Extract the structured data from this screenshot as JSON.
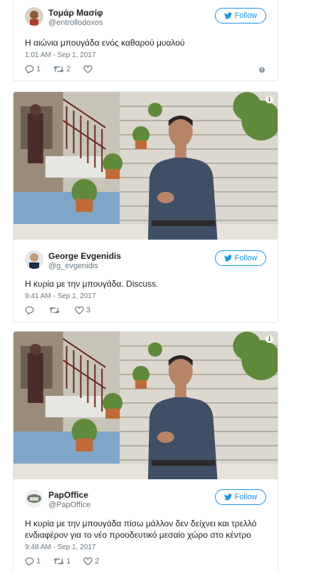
{
  "tweets": [
    {
      "name": "Τομάρ Μασίφ",
      "handle": "@entrollodoxos",
      "follow_label": "Follow",
      "text": "Η αιώνια μπουγάδα ενός καθαρού μυαλού",
      "time": "1:01 AM - Sep 1, 2017",
      "replies": "1",
      "retweets": "2",
      "likes": "",
      "info_icon": "i"
    },
    {
      "name": "George Evgenidis",
      "handle": "@g_evgenidis",
      "follow_label": "Follow",
      "text": "Η κυρία με την μπουγάδα. Discuss.",
      "time": "9:41 AM - Sep 1, 2017",
      "replies": "",
      "retweets": "",
      "likes": "3",
      "media_info_icon": "i"
    },
    {
      "name": "PapOffice",
      "handle": "@PapOffice",
      "follow_label": "Follow",
      "text": "Η κυρία με την μπουγάδα πίσω μάλλον δεν δείχνει και τρελλό ενδιαφέρον για το νέο προοδευτικό μεσαίο χώρο στο κέντρο",
      "time": "9:48 AM - Sep 1, 2017",
      "replies": "1",
      "retweets": "1",
      "likes": "2",
      "media_info_icon": "i"
    }
  ],
  "colors": {
    "twitter_blue": "#1b95e0",
    "meta_gray": "#697882",
    "border": "#e1e8ed"
  }
}
